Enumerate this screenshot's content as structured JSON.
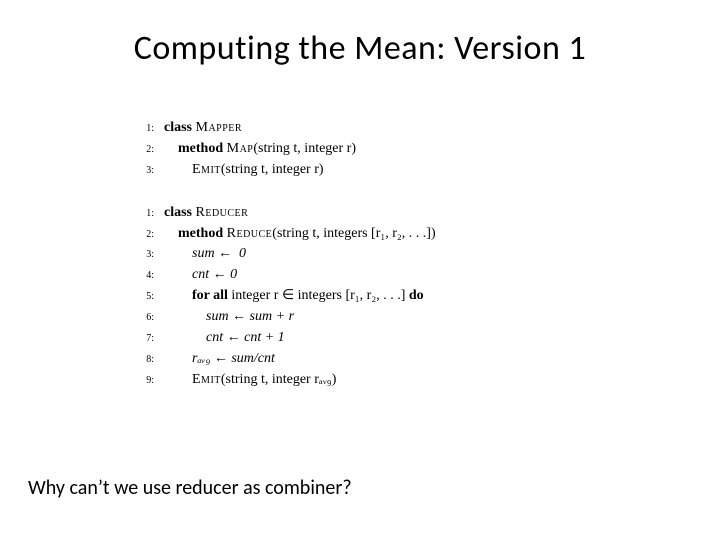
{
  "title": "Computing the Mean: Version 1",
  "question": "Why can’t we use reducer as combiner?",
  "mapper": {
    "l1": {
      "kw": "class",
      "name": "Mapper"
    },
    "l2": {
      "kw": "method",
      "name": "Map",
      "args": "(string t, integer r)"
    },
    "l3": {
      "name": "Emit",
      "args": "(string t, integer r)"
    }
  },
  "reducer": {
    "l1": {
      "kw": "class",
      "name": "Reducer"
    },
    "l2": {
      "kw": "method",
      "name": "Reduce",
      "args": "(string t, integers [r₁, r₂, . . .])"
    },
    "l3": "sum ←  0",
    "l4": "cnt ← 0",
    "l5": {
      "kw1": "for all",
      "mid": " integer r ∈ integers [r₁, r₂, . . .] ",
      "kw2": "do"
    },
    "l6": "sum ← sum + r",
    "l7": "cnt ← cnt + 1",
    "l8": "rₐᵥ₉ ← sum/cnt",
    "l9": {
      "name": "Emit",
      "args": "(string t, integer rₐᵥ₉)"
    }
  },
  "chart_data": {
    "type": "table",
    "title": "Computing the Mean: Version 1 (pseudocode)",
    "series": [
      {
        "name": "Mapper",
        "values": [
          "class Mapper",
          "  method Map(string t, integer r)",
          "    Emit(string t, integer r)"
        ]
      },
      {
        "name": "Reducer",
        "values": [
          "class Reducer",
          "  method Reduce(string t, integers [r1, r2, ...])",
          "    sum ← 0",
          "    cnt ← 0",
          "    for all integer r ∈ integers [r1, r2, ...] do",
          "      sum ← sum + r",
          "      cnt ← cnt + 1",
          "    r_avg ← sum / cnt",
          "    Emit(string t, integer r_avg)"
        ]
      }
    ]
  }
}
